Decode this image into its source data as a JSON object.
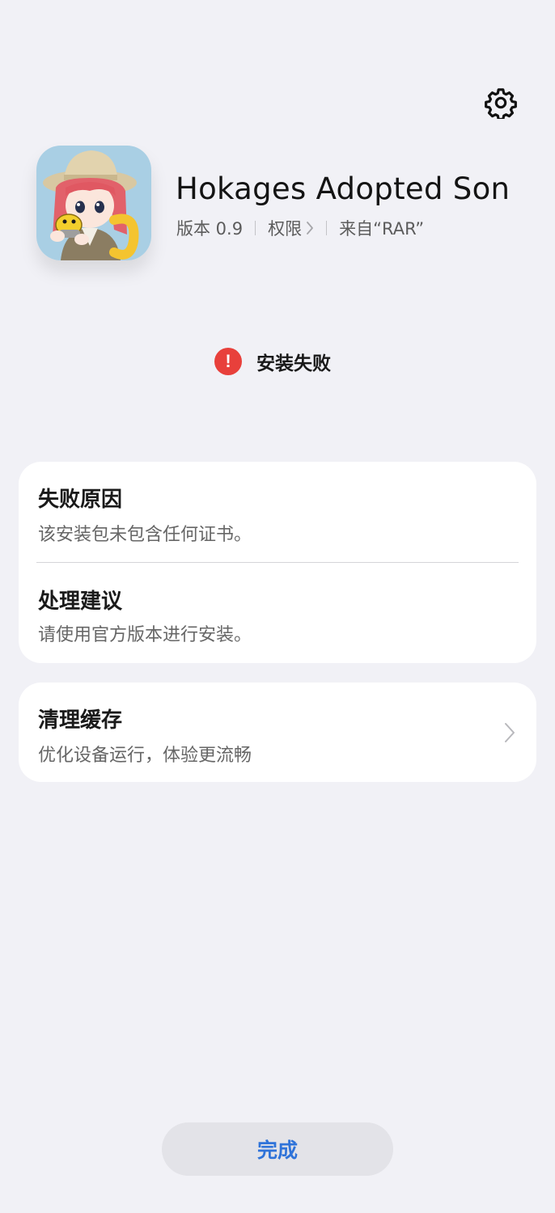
{
  "header": {
    "settings_icon": "gear-icon"
  },
  "app": {
    "name": "Hokages Adopted Son",
    "icon": "app-icon-anime-girl",
    "version": "版本 0.9",
    "permissions_label": "权限",
    "source": "来自“RAR”"
  },
  "status": {
    "icon": "error-exclamation-icon",
    "icon_glyph": "!",
    "text": "安装失败",
    "color": "#e8403b"
  },
  "failure_card": {
    "reason_title": "失败原因",
    "reason_desc": "该安装包未包含任何证书。",
    "suggestion_title": "处理建议",
    "suggestion_desc": "请使用官方版本进行安装。"
  },
  "cache_card": {
    "title": "清理缓存",
    "desc": "优化设备运行，体验更流畅",
    "icon": "chevron-right-icon"
  },
  "footer": {
    "done_label": "完成",
    "accent": "#2f73d9"
  }
}
